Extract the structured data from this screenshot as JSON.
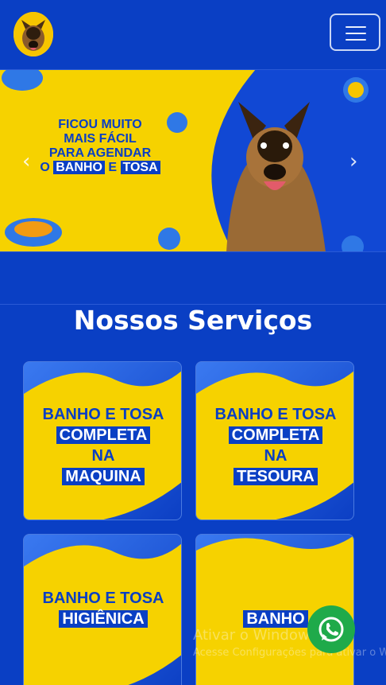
{
  "header": {
    "logo": "dog-logo",
    "menu_icon": "hamburger-icon"
  },
  "banner": {
    "line1": "FICOU MUITO",
    "line2": "MAIS FÁCIL",
    "line3": "PARA AGENDAR",
    "prefix": "O",
    "hl1": "BANHO",
    "mid": "E",
    "hl2": "TOSA",
    "prev_icon": "chevron-left-icon",
    "next_icon": "chevron-right-icon"
  },
  "services": {
    "title": "Nossos Serviços",
    "cards": [
      {
        "l1": "BANHO E TOSA",
        "l2": "COMPLETA",
        "l3": "NA",
        "l4": "MAQUINA"
      },
      {
        "l1": "BANHO E TOSA",
        "l2": "COMPLETA",
        "l3": "NA",
        "l4": "TESOURA"
      },
      {
        "l1": "BANHO E TOSA",
        "l2": "HIGIÊNICA"
      },
      {
        "l1": "BANHO"
      }
    ]
  },
  "whatsapp": {
    "icon": "whatsapp-icon"
  },
  "watermark": {
    "title": "Ativar o Windows",
    "subtitle": "Acesse Configurações para ativar o Windows."
  },
  "colors": {
    "brand_blue": "#0a3fc4",
    "yellow": "#f6d200",
    "whatsapp_green": "#1faa4a"
  }
}
